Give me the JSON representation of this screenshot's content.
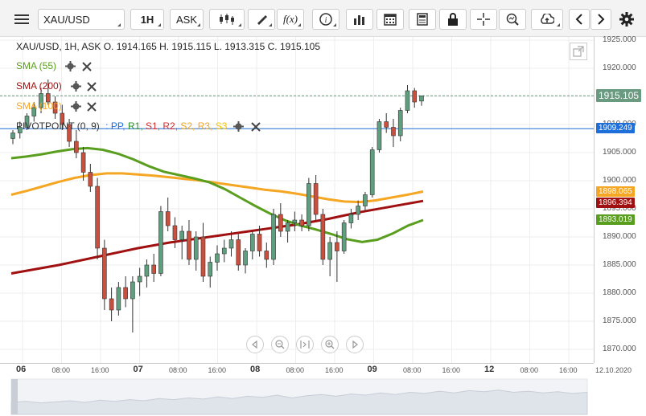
{
  "toolbar": {
    "menu_icon": "hamburger-icon",
    "symbol": "XAU/USD",
    "timeframe": "1H",
    "price_type": "ASK",
    "chart_type_icon": "candlestick-icon",
    "draw_icon": "pencil-icon",
    "indicator_label": "f(x)",
    "info_icon": "info-icon",
    "volume_icon": "bar-chart-icon",
    "calendar_icon": "calendar-icon",
    "news_icon": "document-icon",
    "lock_icon": "lock-icon",
    "crosshair_icon": "crosshair-icon",
    "zoom_icon": "search-icon",
    "upload_icon": "upload-icon",
    "prev_icon": "chevron-left-icon",
    "next_icon": "chevron-right-icon",
    "settings_icon": "gear-icon"
  },
  "legend": {
    "ohlc": "XAU/USD, 1H, ASK   O. 1914.165 H. 1915.115 L. 1913.315 C. 1915.105",
    "sma55": "SMA (55)",
    "sma200": "SMA (200)",
    "sma100": "SMA (100)",
    "pivot_prefix": "PIVOTPOINT (0, 9)",
    "pivot_sep": ":",
    "pivot_parts": [
      {
        "text": "PP,",
        "color": "#1e6fd9"
      },
      {
        "text": "R1,",
        "color": "#2e8b2e"
      },
      {
        "text": "S1,",
        "color": "#d32f2f"
      },
      {
        "text": "R2,",
        "color": "#d32f2f"
      },
      {
        "text": "S2,",
        "color": "#f5a623"
      },
      {
        "text": "R3,",
        "color": "#f5a623"
      },
      {
        "text": "S3",
        "color": "#f5c400"
      }
    ]
  },
  "colors": {
    "sma55": "#5a9e1f",
    "sma200": "#a01010",
    "sma100": "#f5a623",
    "pivot": "#1e6fd9",
    "bull": "#5f9f7f",
    "bear": "#c9503e",
    "price_badge": "#6a9a80"
  },
  "yaxis": {
    "ticks": [
      "1925.000",
      "1920.000",
      "1915.000",
      "1910.000",
      "1905.000",
      "1900.000",
      "1895.000",
      "1890.000",
      "1885.000",
      "1880.000",
      "1875.000",
      "1870.000"
    ],
    "badges": {
      "price": "1915.105",
      "pivot": "1909.249",
      "sma100": "1898.065",
      "sma200": "1896.394",
      "sma55": "1893.019"
    }
  },
  "xaxis": {
    "ticks": [
      {
        "label": "06",
        "bold": true
      },
      {
        "label": "08:00",
        "bold": false
      },
      {
        "label": "16:00",
        "bold": false
      },
      {
        "label": "07",
        "bold": true
      },
      {
        "label": "08:00",
        "bold": false
      },
      {
        "label": "16:00",
        "bold": false
      },
      {
        "label": "08",
        "bold": true
      },
      {
        "label": "08:00",
        "bold": false
      },
      {
        "label": "16:00",
        "bold": false
      },
      {
        "label": "09",
        "bold": true
      },
      {
        "label": "08:00",
        "bold": false
      },
      {
        "label": "16:00",
        "bold": false
      },
      {
        "label": "12",
        "bold": true
      },
      {
        "label": "08:00",
        "bold": false
      },
      {
        "label": "16:00",
        "bold": false
      }
    ],
    "date_label": "12.10.2020"
  },
  "nav_icons": [
    "arrow-left-icon",
    "zoom-out-icon",
    "fit-icon",
    "zoom-in-icon",
    "arrow-right-icon"
  ],
  "chart_data": {
    "type": "candlestick",
    "symbol": "XAU/USD",
    "ylim": [
      1868,
      1926
    ],
    "current_price": 1915.105,
    "pivot_level": 1909.249,
    "candles": [
      [
        1907.5,
        1909.0,
        1906.5,
        1908.5
      ],
      [
        1908.5,
        1910.5,
        1907.5,
        1909.5
      ],
      [
        1909.5,
        1912.0,
        1909.0,
        1911.5
      ],
      [
        1911.5,
        1914.0,
        1910.5,
        1913.0
      ],
      [
        1913.0,
        1916.5,
        1912.0,
        1915.5
      ],
      [
        1915.5,
        1918.0,
        1913.5,
        1914.0
      ],
      [
        1914.0,
        1915.0,
        1911.0,
        1912.0
      ],
      [
        1912.0,
        1913.5,
        1909.0,
        1910.0
      ],
      [
        1910.0,
        1911.0,
        1906.0,
        1907.0
      ],
      [
        1907.0,
        1909.0,
        1904.0,
        1905.0
      ],
      [
        1905.0,
        1906.0,
        1900.0,
        1901.5
      ],
      [
        1901.5,
        1903.0,
        1898.0,
        1899.0
      ],
      [
        1899.0,
        1900.5,
        1886.0,
        1888.0
      ],
      [
        1888.0,
        1889.5,
        1877.0,
        1879.0
      ],
      [
        1879.0,
        1881.0,
        1875.0,
        1877.0
      ],
      [
        1877.0,
        1882.0,
        1876.0,
        1881.0
      ],
      [
        1881.0,
        1883.0,
        1877.5,
        1879.0
      ],
      [
        1879.0,
        1883.0,
        1873.0,
        1882.0
      ],
      [
        1882.0,
        1884.5,
        1879.5,
        1883.0
      ],
      [
        1883.0,
        1886.0,
        1881.0,
        1885.0
      ],
      [
        1885.0,
        1887.0,
        1882.0,
        1883.5
      ],
      [
        1883.5,
        1895.5,
        1883.0,
        1894.5
      ],
      [
        1894.5,
        1897.0,
        1891.0,
        1892.0
      ],
      [
        1892.0,
        1893.5,
        1888.0,
        1889.5
      ],
      [
        1889.5,
        1892.0,
        1886.0,
        1891.0
      ],
      [
        1891.0,
        1893.0,
        1885.0,
        1886.0
      ],
      [
        1886.0,
        1891.0,
        1884.0,
        1890.0
      ],
      [
        1890.0,
        1892.5,
        1882.0,
        1883.0
      ],
      [
        1883.0,
        1886.5,
        1881.0,
        1885.5
      ],
      [
        1885.5,
        1888.5,
        1884.0,
        1887.0
      ],
      [
        1887.0,
        1889.5,
        1885.5,
        1888.0
      ],
      [
        1888.0,
        1891.0,
        1886.5,
        1889.5
      ],
      [
        1889.5,
        1890.5,
        1884.0,
        1885.0
      ],
      [
        1885.0,
        1888.0,
        1883.5,
        1887.5
      ],
      [
        1887.5,
        1891.0,
        1886.0,
        1890.5
      ],
      [
        1890.5,
        1892.0,
        1886.5,
        1887.5
      ],
      [
        1887.5,
        1889.0,
        1884.5,
        1886.0
      ],
      [
        1886.0,
        1895.0,
        1885.0,
        1894.0
      ],
      [
        1894.0,
        1896.0,
        1890.0,
        1891.0
      ],
      [
        1891.0,
        1893.0,
        1889.0,
        1892.5
      ],
      [
        1892.5,
        1894.5,
        1891.0,
        1893.0
      ],
      [
        1893.0,
        1894.0,
        1891.0,
        1892.0
      ],
      [
        1892.0,
        1900.5,
        1891.0,
        1899.5
      ],
      [
        1899.5,
        1901.0,
        1893.0,
        1894.0
      ],
      [
        1894.0,
        1895.0,
        1885.0,
        1886.0
      ],
      [
        1886.0,
        1890.0,
        1883.0,
        1889.0
      ],
      [
        1889.0,
        1891.0,
        1882.0,
        1887.5
      ],
      [
        1887.5,
        1893.0,
        1887.0,
        1892.5
      ],
      [
        1892.5,
        1895.0,
        1891.5,
        1894.0
      ],
      [
        1894.0,
        1896.5,
        1893.0,
        1895.5
      ],
      [
        1895.5,
        1898.0,
        1894.5,
        1897.5
      ],
      [
        1897.5,
        1906.0,
        1897.0,
        1905.5
      ],
      [
        1905.5,
        1911.0,
        1905.0,
        1910.5
      ],
      [
        1910.5,
        1912.0,
        1908.5,
        1909.5
      ],
      [
        1909.5,
        1911.0,
        1906.0,
        1908.0
      ],
      [
        1908.0,
        1913.0,
        1907.0,
        1912.5
      ],
      [
        1912.5,
        1917.0,
        1912.0,
        1916.0
      ],
      [
        1916.0,
        1916.5,
        1913.0,
        1914.0
      ],
      [
        1914.165,
        1915.115,
        1913.315,
        1915.105
      ]
    ],
    "sma55": [
      1904.0,
      1904.3,
      1904.7,
      1905.2,
      1905.6,
      1905.8,
      1905.5,
      1904.8,
      1903.8,
      1902.6,
      1901.6,
      1901.0,
      1900.4,
      1899.7,
      1898.5,
      1897.0,
      1895.5,
      1894.1,
      1892.9,
      1892.0,
      1891.3,
      1890.5,
      1889.6,
      1889.1,
      1889.5,
      1890.6,
      1892.0,
      1893.0
    ],
    "sma200": [
      1883.5,
      1884.0,
      1884.5,
      1885.0,
      1885.6,
      1886.2,
      1886.8,
      1887.4,
      1888.0,
      1888.5,
      1889.0,
      1889.4,
      1889.8,
      1890.2,
      1890.6,
      1891.0,
      1891.4,
      1891.8,
      1892.2,
      1892.7,
      1893.2,
      1893.8,
      1894.4,
      1894.9,
      1895.4,
      1895.9,
      1896.4
    ],
    "sma100": [
      1897.5,
      1898.2,
      1899.0,
      1899.8,
      1900.5,
      1901.0,
      1901.3,
      1901.3,
      1901.1,
      1900.9,
      1900.6,
      1900.3,
      1900.0,
      1899.6,
      1899.2,
      1898.8,
      1898.4,
      1898.1,
      1897.7,
      1897.2,
      1896.7,
      1896.3,
      1896.2,
      1896.5,
      1897.0,
      1897.5,
      1898.065
    ]
  }
}
